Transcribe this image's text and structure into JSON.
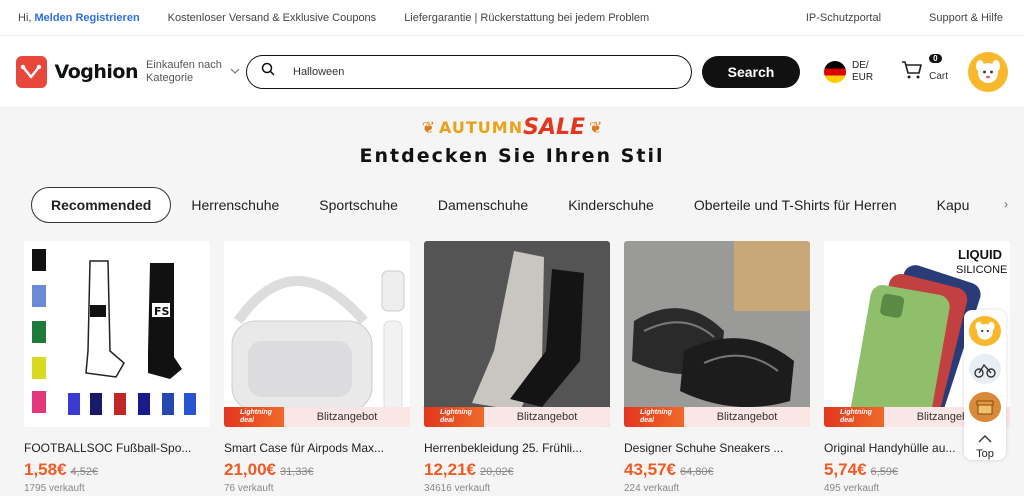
{
  "topbar": {
    "greeting": "Hi, ",
    "login_link": "Melden",
    "register_link": "Registrieren",
    "shipping": "Kostenloser Versand & Exklusive Coupons",
    "guarantee": "Liefergarantie | Rückerstattung bei jedem Problem",
    "ip": "IP-Schutzportal",
    "help": "Support & Hilfe"
  },
  "header": {
    "brand": "Voghion",
    "category_label_1": "Einkaufen nach",
    "category_label_2": "Kategorie",
    "search_value": "Halloween",
    "search_button": "Search",
    "locale_1": "DE/",
    "locale_2": "EUR",
    "cart_count": "0",
    "cart_label": "Cart"
  },
  "banner": {
    "autumn": "AUTUMN",
    "sale": "SALE",
    "tagline": "Entdecken Sie Ihren Stil"
  },
  "tabs": [
    "Recommended",
    "Herrenschuhe",
    "Sportschuhe",
    "Damenschuhe",
    "Kinderschuhe",
    "Oberteile und T-Shirts für Herren",
    "Kapu"
  ],
  "products": [
    {
      "title": "FOOTBALLSOC Fußball-Spo...",
      "price": "1,58€",
      "old": "4,52€",
      "sold": "1795 verkauft",
      "deal": false
    },
    {
      "title": "Smart Case für Airpods Max...",
      "price": "21,00€",
      "old": "31,33€",
      "sold": "76 verkauft",
      "deal": true
    },
    {
      "title": "Herrenbekleidung 25. Frühli...",
      "price": "12,21€",
      "old": "20,02€",
      "sold": "34616 verkauft",
      "deal": true
    },
    {
      "title": "Designer Schuhe Sneakers ...",
      "price": "43,57€",
      "old": "64,80€",
      "sold": "224 verkauft",
      "deal": true
    },
    {
      "title": "Original Handyhülle au...",
      "price": "5,74€",
      "old": "6,59€",
      "sold": "495 verkauft",
      "deal": true
    }
  ],
  "deal_labels": {
    "lightning_1": "Lightning",
    "lightning_2": "deal",
    "blitz": "Blitzangebot"
  },
  "product_image_text": {
    "liquid": "LIQUID",
    "silicone": "SILICONE",
    "fs": "FS"
  },
  "float": {
    "top_label": "Top"
  },
  "colors": {
    "accent": "#f05a24",
    "brand": "#e8473b",
    "link": "#2f6fe4"
  }
}
